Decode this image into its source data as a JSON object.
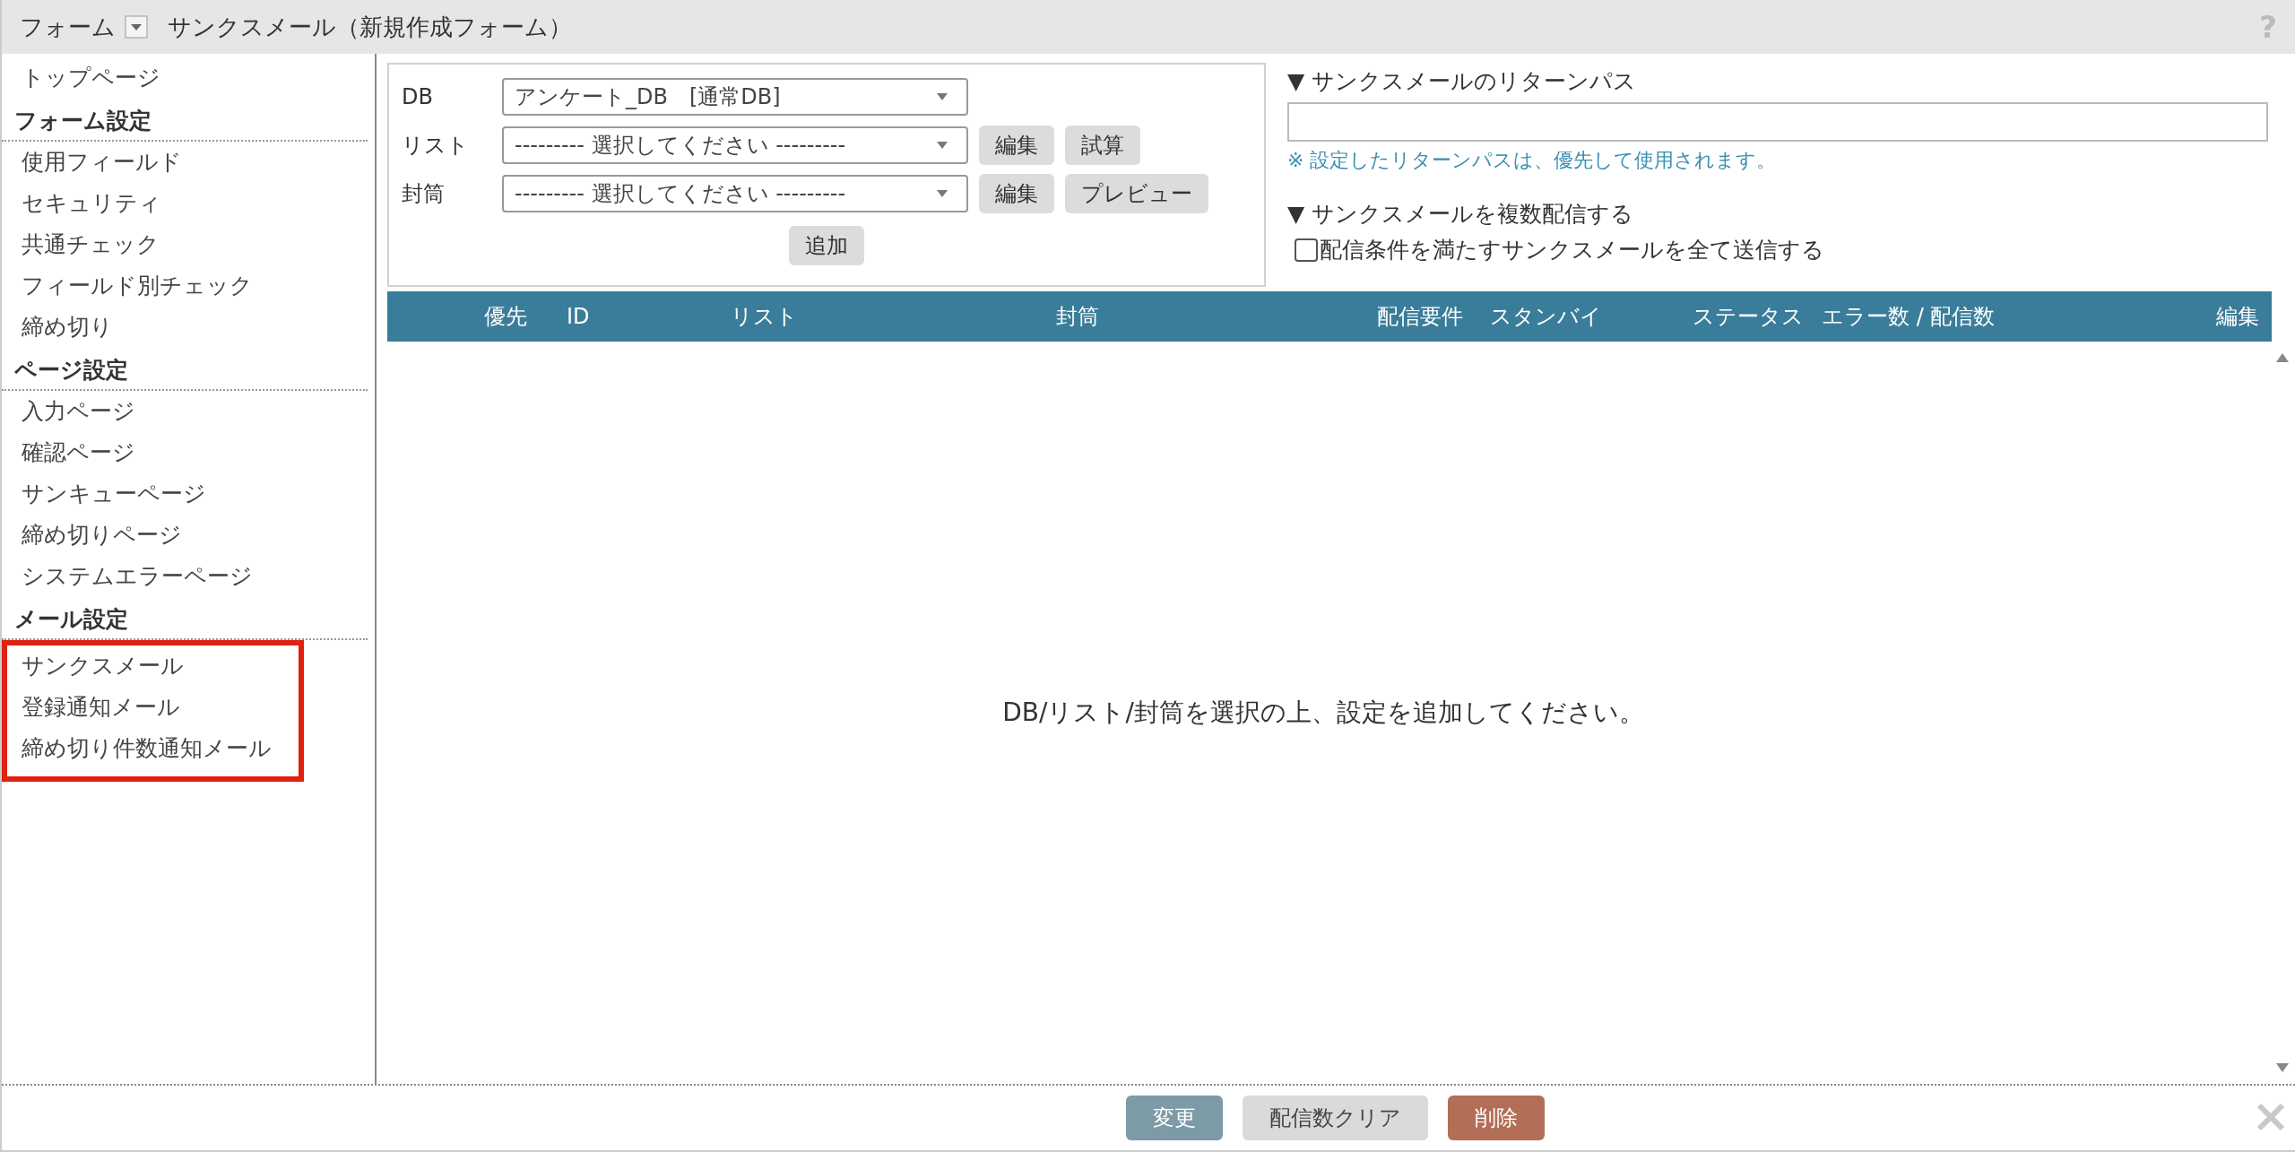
{
  "top_bar": {
    "menu_label": "フォーム",
    "title": "サンクスメール（新規作成フォーム）",
    "help": "?"
  },
  "sidebar": {
    "top_link": "トップページ",
    "sections": [
      {
        "heading": "フォーム設定",
        "highlighted": false,
        "items": [
          "使用フィールド",
          "セキュリティ",
          "共通チェック",
          "フィールド別チェック",
          "締め切り"
        ]
      },
      {
        "heading": "ページ設定",
        "highlighted": false,
        "items": [
          "入力ページ",
          "確認ページ",
          "サンキューページ",
          "締め切りページ",
          "システムエラーページ"
        ]
      },
      {
        "heading": "メール設定",
        "highlighted": true,
        "items": [
          "サンクスメール",
          "登録通知メール",
          "締め切り件数通知メール"
        ]
      }
    ]
  },
  "form": {
    "rows": [
      {
        "label": "DB",
        "value": "アンケート_DB　[通常DB]",
        "buttons": []
      },
      {
        "label": "リスト",
        "value": "--------- 選択してください ---------",
        "buttons": [
          "編集",
          "試算"
        ]
      },
      {
        "label": "封筒",
        "value": "--------- 選択してください ---------",
        "buttons": [
          "編集",
          "プレビュー"
        ]
      }
    ],
    "add_button": "追加"
  },
  "return_path": {
    "heading": "▼ サンクスメールのリターンパス",
    "note": "※ 設定したリターンパスは、優先して使用されます。"
  },
  "multi_send": {
    "heading": "▼ サンクスメールを複数配信する",
    "checkbox": {
      "label": "配信条件を満たすサンクスメールを全て送信する",
      "checked": false
    }
  },
  "table": {
    "columns": [
      "優先",
      "ID",
      "リスト",
      "封筒",
      "配信要件",
      "スタンバイ",
      "ステータス",
      "エラー数 / 配信数",
      "編集"
    ],
    "empty_message": "DB/リスト/封筒を選択の上、設定を追加してください。"
  },
  "footer": {
    "buttons": [
      {
        "label": "変更",
        "kind": "primary"
      },
      {
        "label": "配信数クリア",
        "kind": "neutral"
      },
      {
        "label": "削除",
        "kind": "danger"
      }
    ]
  }
}
